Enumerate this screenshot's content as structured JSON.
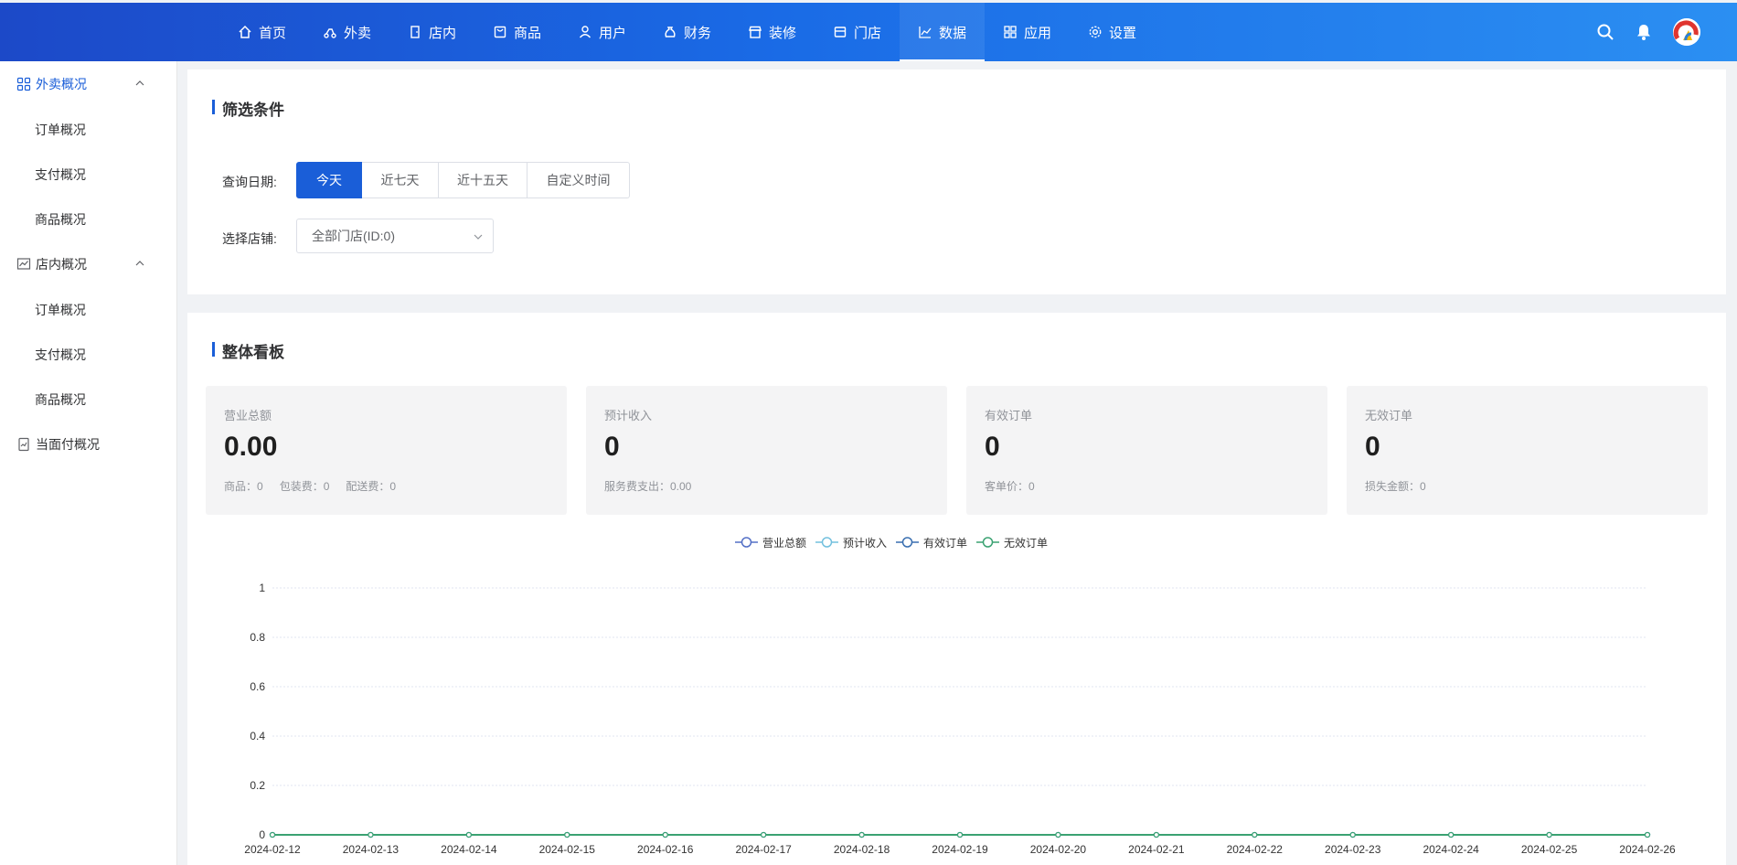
{
  "nav": {
    "items": [
      {
        "label": "首页",
        "icon": "home-icon"
      },
      {
        "label": "外卖",
        "icon": "scooter-icon"
      },
      {
        "label": "店内",
        "icon": "door-icon"
      },
      {
        "label": "商品",
        "icon": "product-icon"
      },
      {
        "label": "用户",
        "icon": "user-icon"
      },
      {
        "label": "财务",
        "icon": "money-bag-icon"
      },
      {
        "label": "装修",
        "icon": "store-front-icon"
      },
      {
        "label": "门店",
        "icon": "shop-icon"
      },
      {
        "label": "数据",
        "icon": "line-chart-icon",
        "active": true
      },
      {
        "label": "应用",
        "icon": "grid-icon"
      },
      {
        "label": "设置",
        "icon": "gear-icon"
      }
    ]
  },
  "sidebar": {
    "groups": [
      {
        "label": "外卖概况",
        "icon": "grid-icon",
        "active": true,
        "items": [
          "订单概况",
          "支付概况",
          "商品概况"
        ]
      },
      {
        "label": "店内概况",
        "icon": "chart-box-icon",
        "items": [
          "订单概况",
          "支付概况",
          "商品概况"
        ]
      },
      {
        "label": "当面付概况",
        "icon": "report-icon",
        "items": []
      }
    ]
  },
  "filter": {
    "title": "筛选条件",
    "date_label": "查询日期:",
    "date_options": [
      "今天",
      "近七天",
      "近十五天",
      "自定义时间"
    ],
    "date_selected": "今天",
    "store_label": "选择店铺:",
    "store_value": "全部门店(ID:0)"
  },
  "board": {
    "title": "整体看板",
    "stats": [
      {
        "label": "营业总额",
        "value": "0.00",
        "subs": [
          "商品：0",
          "包装费：0",
          "配送费：0"
        ]
      },
      {
        "label": "预计收入",
        "value": "0",
        "subs": [
          "服务费支出：0.00"
        ]
      },
      {
        "label": "有效订单",
        "value": "0",
        "subs": [
          "客单价：0"
        ]
      },
      {
        "label": "无效订单",
        "value": "0",
        "subs": [
          "损失金额：0"
        ]
      }
    ]
  },
  "chart_data": {
    "type": "line",
    "x": [
      "2024-02-12",
      "2024-02-13",
      "2024-02-14",
      "2024-02-15",
      "2024-02-16",
      "2024-02-17",
      "2024-02-18",
      "2024-02-19",
      "2024-02-20",
      "2024-02-21",
      "2024-02-22",
      "2024-02-23",
      "2024-02-24",
      "2024-02-25",
      "2024-02-26"
    ],
    "series": [
      {
        "name": "营业总额",
        "color": "#5470c6",
        "values": [
          0,
          0,
          0,
          0,
          0,
          0,
          0,
          0,
          0,
          0,
          0,
          0,
          0,
          0,
          0
        ]
      },
      {
        "name": "预计收入",
        "color": "#73c0de",
        "values": [
          0,
          0,
          0,
          0,
          0,
          0,
          0,
          0,
          0,
          0,
          0,
          0,
          0,
          0,
          0
        ]
      },
      {
        "name": "有效订单",
        "color": "#3a6fb0",
        "values": [
          0,
          0,
          0,
          0,
          0,
          0,
          0,
          0,
          0,
          0,
          0,
          0,
          0,
          0,
          0
        ]
      },
      {
        "name": "无效订单",
        "color": "#3ba272",
        "values": [
          0,
          0,
          0,
          0,
          0,
          0,
          0,
          0,
          0,
          0,
          0,
          0,
          0,
          0,
          0
        ]
      }
    ],
    "yticks": [
      "0",
      "0.2",
      "0.4",
      "0.6",
      "0.8",
      "1"
    ],
    "ylim": [
      0,
      1
    ],
    "grid": true,
    "legend": "top-center"
  }
}
